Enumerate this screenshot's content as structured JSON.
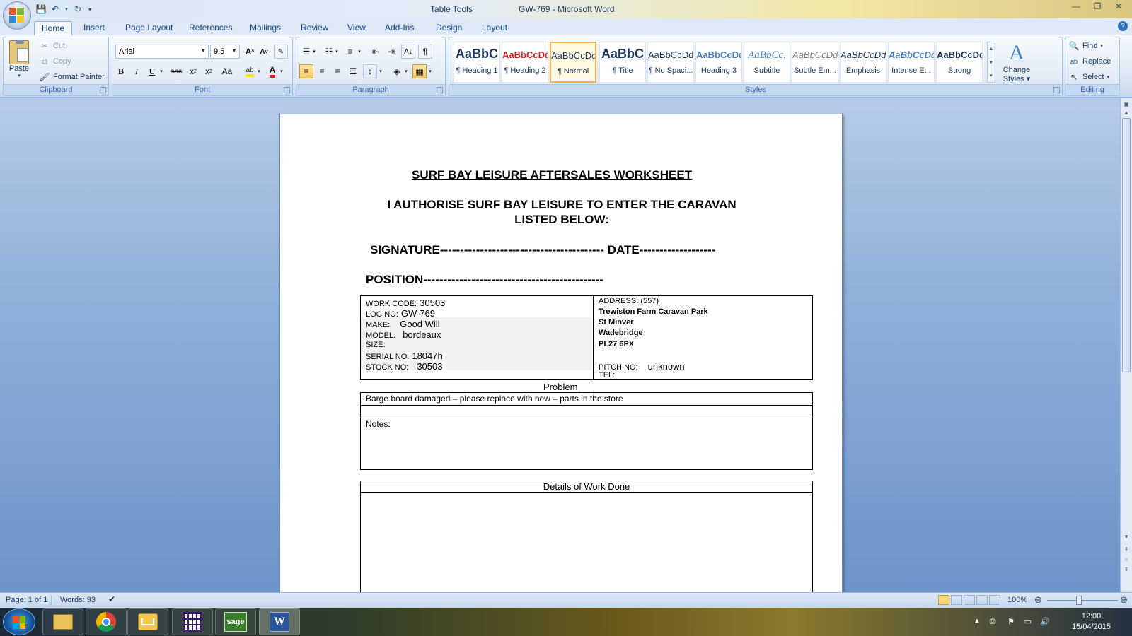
{
  "titlebar": {
    "contextual_tab": "Table Tools",
    "document_title": "GW-769 - Microsoft Word",
    "quick_access": [
      "save-icon",
      "undo-icon",
      "redo-icon",
      "customize-icon"
    ],
    "window_controls": [
      "minimize",
      "restore",
      "close"
    ]
  },
  "tabs": [
    "Home",
    "Insert",
    "Page Layout",
    "References",
    "Mailings",
    "Review",
    "View",
    "Add-Ins",
    "Design",
    "Layout"
  ],
  "clipboard": {
    "paste": "Paste",
    "cut": "Cut",
    "copy": "Copy",
    "format_painter": "Format Painter",
    "label": "Clipboard"
  },
  "font": {
    "family": "Arial",
    "size": "9.5",
    "label": "Font",
    "change_case": "Aa"
  },
  "paragraph": {
    "label": "Paragraph"
  },
  "styles": {
    "label": "Styles",
    "items": [
      {
        "preview": "AaBbC",
        "name": "¶ Heading 1"
      },
      {
        "preview": "AaBbCcDd",
        "name": "¶ Heading 2"
      },
      {
        "preview": "AaBbCcDd",
        "name": "¶ Normal"
      },
      {
        "preview": "AaBbC",
        "name": "¶ Title"
      },
      {
        "preview": "AaBbCcDd",
        "name": "¶ No Spaci..."
      },
      {
        "preview": "AaBbCcDd",
        "name": "Heading 3"
      },
      {
        "preview": "AaBbCc.",
        "name": "Subtitle"
      },
      {
        "preview": "AaBbCcDd",
        "name": "Subtle Em..."
      },
      {
        "preview": "AaBbCcDd",
        "name": "Emphasis"
      },
      {
        "preview": "AaBbCcDd",
        "name": "Intense E..."
      },
      {
        "preview": "AaBbCcDd",
        "name": "Strong"
      }
    ],
    "change_styles_1": "Change",
    "change_styles_2": "Styles"
  },
  "editing": {
    "find": "Find",
    "replace": "Replace",
    "select": "Select",
    "label": "Editing"
  },
  "document": {
    "heading": "SURF BAY LEISURE AFTERSALES WORKSHEET",
    "authorise_1": "I AUTHORISE SURF BAY LEISURE TO ENTER THE CARAVAN",
    "authorise_2": "LISTED BELOW:",
    "signature": "SIGNATURE----------------------------------------- DATE-------------------",
    "position": "POSITION---------------------------------------------",
    "left": {
      "work_code_label": "WORK CODE:",
      "work_code": "30503",
      "log_no_label": "LOG NO:",
      "log_no": "GW-769",
      "make_label": "MAKE:",
      "make": "Good Will",
      "model_label": "MODEL:",
      "model": "bordeaux",
      "size_label": "SIZE:",
      "serial_label": "SERIAL NO:",
      "serial": "18047h",
      "stock_label": "STOCK NO:",
      "stock": "30503"
    },
    "right": {
      "address_label": "ADDRESS:",
      "address_code": "(557)",
      "line1": "Trewiston Farm Caravan Park",
      "line2": "St Minver",
      "line3": "Wadebridge",
      "line4": "PL27 6PX",
      "pitch_label": "PITCH NO:",
      "pitch": "unknown",
      "tel_label": "TEL:"
    },
    "problem_label": "Problem",
    "problem_text": "Barge board damaged – please replace with new – parts in the store",
    "notes_label": "Notes:",
    "work_done_label": "Details of Work Done"
  },
  "statusbar": {
    "page": "Page: 1 of 1",
    "words": "Words: 93",
    "zoom": "100%"
  },
  "taskbar": {
    "apps": [
      "explorer-icon",
      "chrome-icon",
      "outlook-icon",
      "calendar-app-icon",
      "sage-icon",
      "word-icon"
    ],
    "sage_label": "sage",
    "time": "12:00",
    "date": "15/04/2015"
  }
}
